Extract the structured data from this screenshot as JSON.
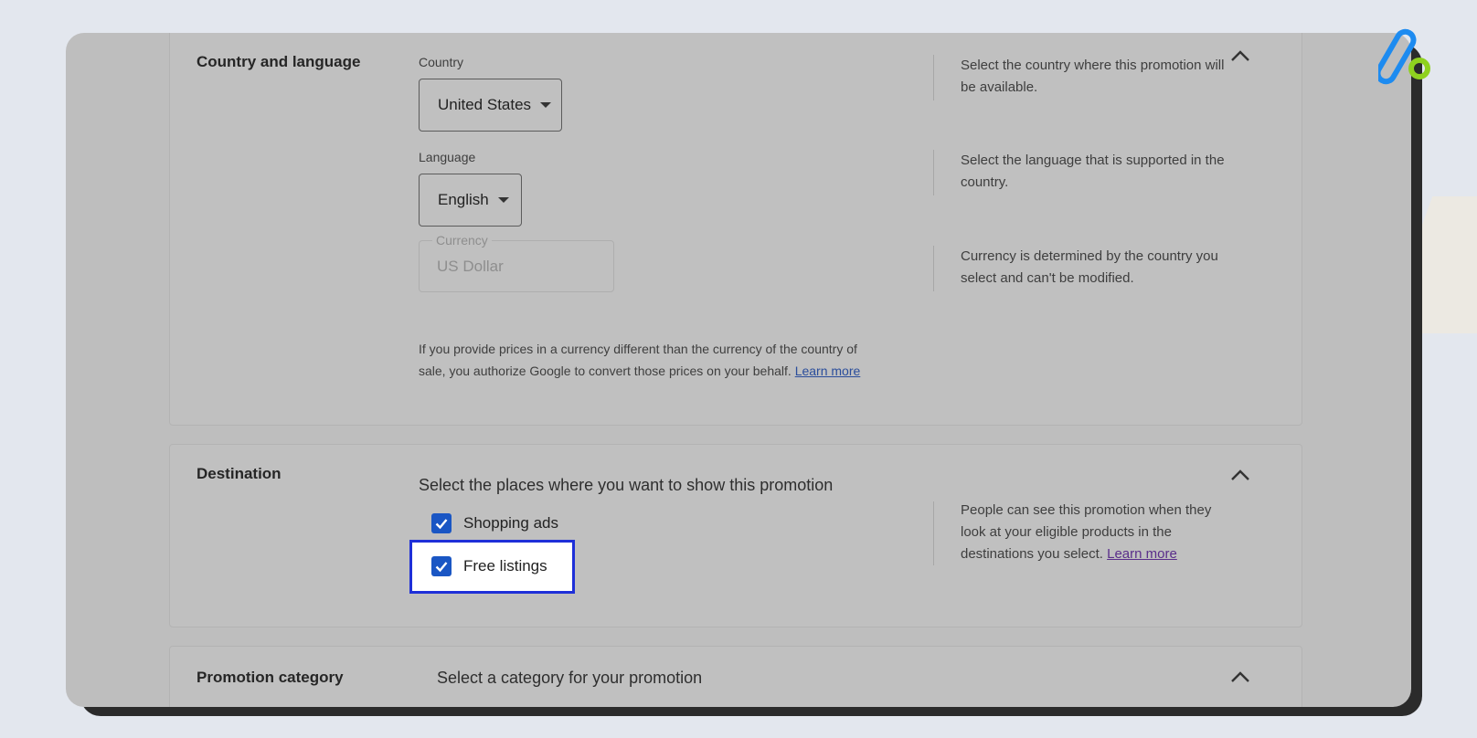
{
  "country_section": {
    "title": "Country and language",
    "country_label": "Country",
    "country_value": "United States",
    "country_help": "Select the country where this promotion will be available.",
    "language_label": "Language",
    "language_value": "English",
    "language_help": "Select the language that is supported in the country.",
    "currency_label": "Currency",
    "currency_value": "US Dollar",
    "currency_help": "Currency is determined by the country you select and can't be modified.",
    "note": "If you provide prices in a currency different than the currency of the country of sale, you authorize Google to convert those prices on your behalf.",
    "learn_more": "Learn more"
  },
  "destination_section": {
    "title": "Destination",
    "prompt": "Select the places where you want to show this promotion",
    "options": [
      {
        "label": "Shopping ads",
        "checked": true
      },
      {
        "label": "Free listings",
        "checked": true,
        "highlighted": true
      }
    ],
    "help": "People can see this promotion when they look at your eligible products in the destinations you select.",
    "learn_more": "Learn more"
  },
  "promotion_category_section": {
    "title": "Promotion category",
    "prompt": "Select a category for your promotion"
  },
  "colors": {
    "checkbox": "#1a56c4",
    "highlight_border": "#1e2fd8",
    "overlay": "#bebebe"
  },
  "icons": [
    "chevron-up-icon",
    "dropdown-caret-icon",
    "checkmark-icon",
    "brand-logo-icon"
  ]
}
